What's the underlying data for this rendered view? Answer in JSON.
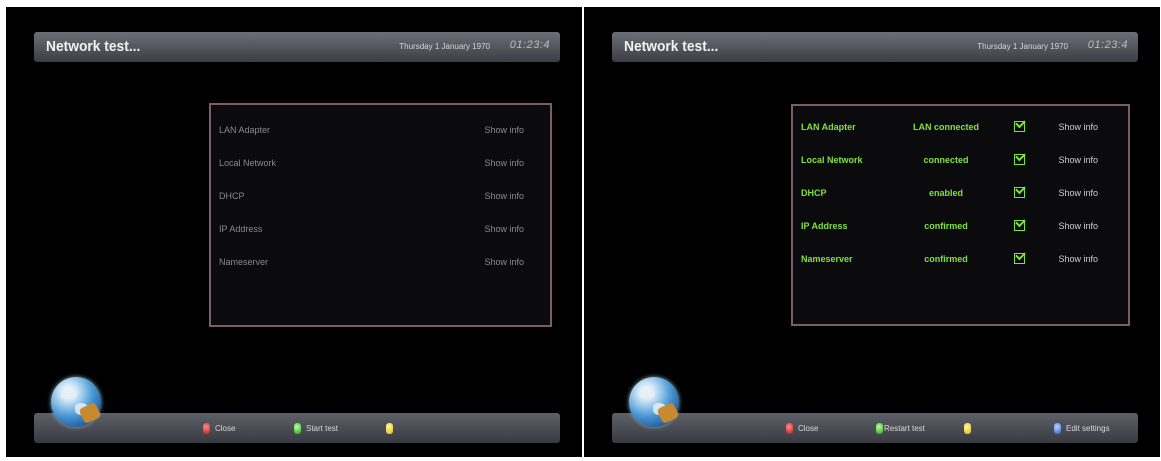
{
  "left": {
    "title": "Network test...",
    "date": "Thursday 1 January 1970",
    "time": "01:23:4",
    "rows": [
      {
        "label": "LAN Adapter",
        "info": "Show info"
      },
      {
        "label": "Local Network",
        "info": "Show info"
      },
      {
        "label": "DHCP",
        "info": "Show info"
      },
      {
        "label": "IP Address",
        "info": "Show info"
      },
      {
        "label": "Nameserver",
        "info": "Show info"
      }
    ],
    "keys": {
      "red": "Close",
      "green": "Start test",
      "yellow": ""
    }
  },
  "right": {
    "title": "Network test...",
    "date": "Thursday 1 January 1970",
    "time": "01:23:4",
    "rows": [
      {
        "label": "LAN Adapter",
        "value": "LAN connected",
        "info": "Show info"
      },
      {
        "label": "Local Network",
        "value": "connected",
        "info": "Show info"
      },
      {
        "label": "DHCP",
        "value": "enabled",
        "info": "Show info"
      },
      {
        "label": "IP Address",
        "value": "confirmed",
        "info": "Show info"
      },
      {
        "label": "Nameserver",
        "value": "confirmed",
        "info": "Show info"
      }
    ],
    "keys": {
      "red": "Close",
      "green": "Restart test",
      "yellow": "",
      "blue": "Edit settings"
    }
  },
  "colors": {
    "ok_green": "#7ee23d",
    "panel_border": "#7d5c68"
  },
  "icons": {
    "globe": "network-globe-icon",
    "check": "checkbox-checked-icon"
  }
}
